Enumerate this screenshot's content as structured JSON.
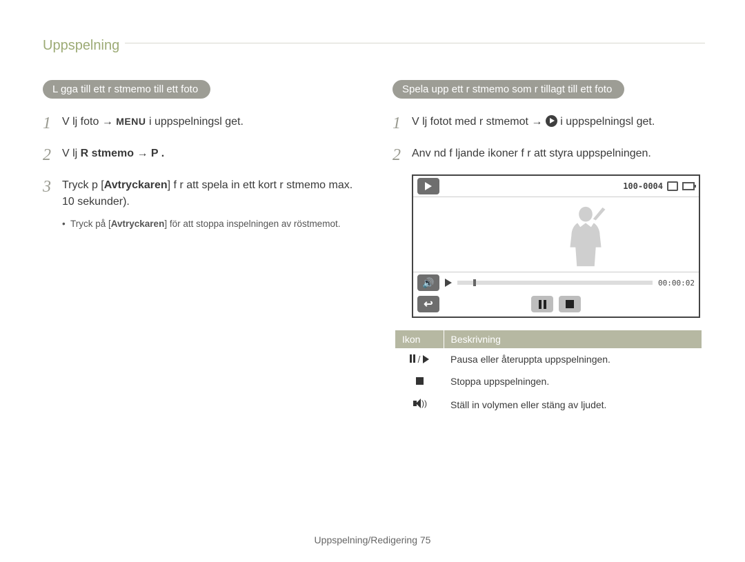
{
  "section_title": "Uppspelning",
  "left": {
    "pill": "L gga till ett r stmemo till ett foto",
    "steps": {
      "s1_a": "V lj foto ",
      "s1_arrow": " → ",
      "s1_menu": "MENU",
      "s1_b": " i uppspelningsl get.",
      "s2_a": "V lj ",
      "s2_bold": "R stmemo",
      "s2_arrow": " → ",
      "s2_b": "P .",
      "s3_a": "Tryck p  [",
      "s3_bold": "Avtryckaren",
      "s3_b": "] f r att spela in ett kort r stmemo max. 10 sekunder).",
      "bullet_a": "Tryck på [",
      "bullet_bold": "Avtryckaren",
      "bullet_b": "] för att stoppa inspelningen av röstmemot."
    }
  },
  "right": {
    "pill": "Spela upp ett r stmemo som  r tillagt till ett foto",
    "steps": {
      "s1_a": "V lj fotot med r stmemot  → ",
      "s1_b": " i uppspelningsl get.",
      "s2": "Anv nd f ljande ikoner f r att styra uppspelningen."
    },
    "lcd": {
      "counter": "100-0004",
      "time": "00:00:02"
    },
    "table": {
      "h1": "Ikon",
      "h2": "Beskrivning",
      "r1": "Pausa eller återuppta uppspelningen.",
      "r2": "Stoppa uppspelningen.",
      "r3": "Ställ in volymen eller stäng av ljudet."
    }
  },
  "footer": {
    "label": "Uppspelning/Redigering",
    "page": "75"
  }
}
